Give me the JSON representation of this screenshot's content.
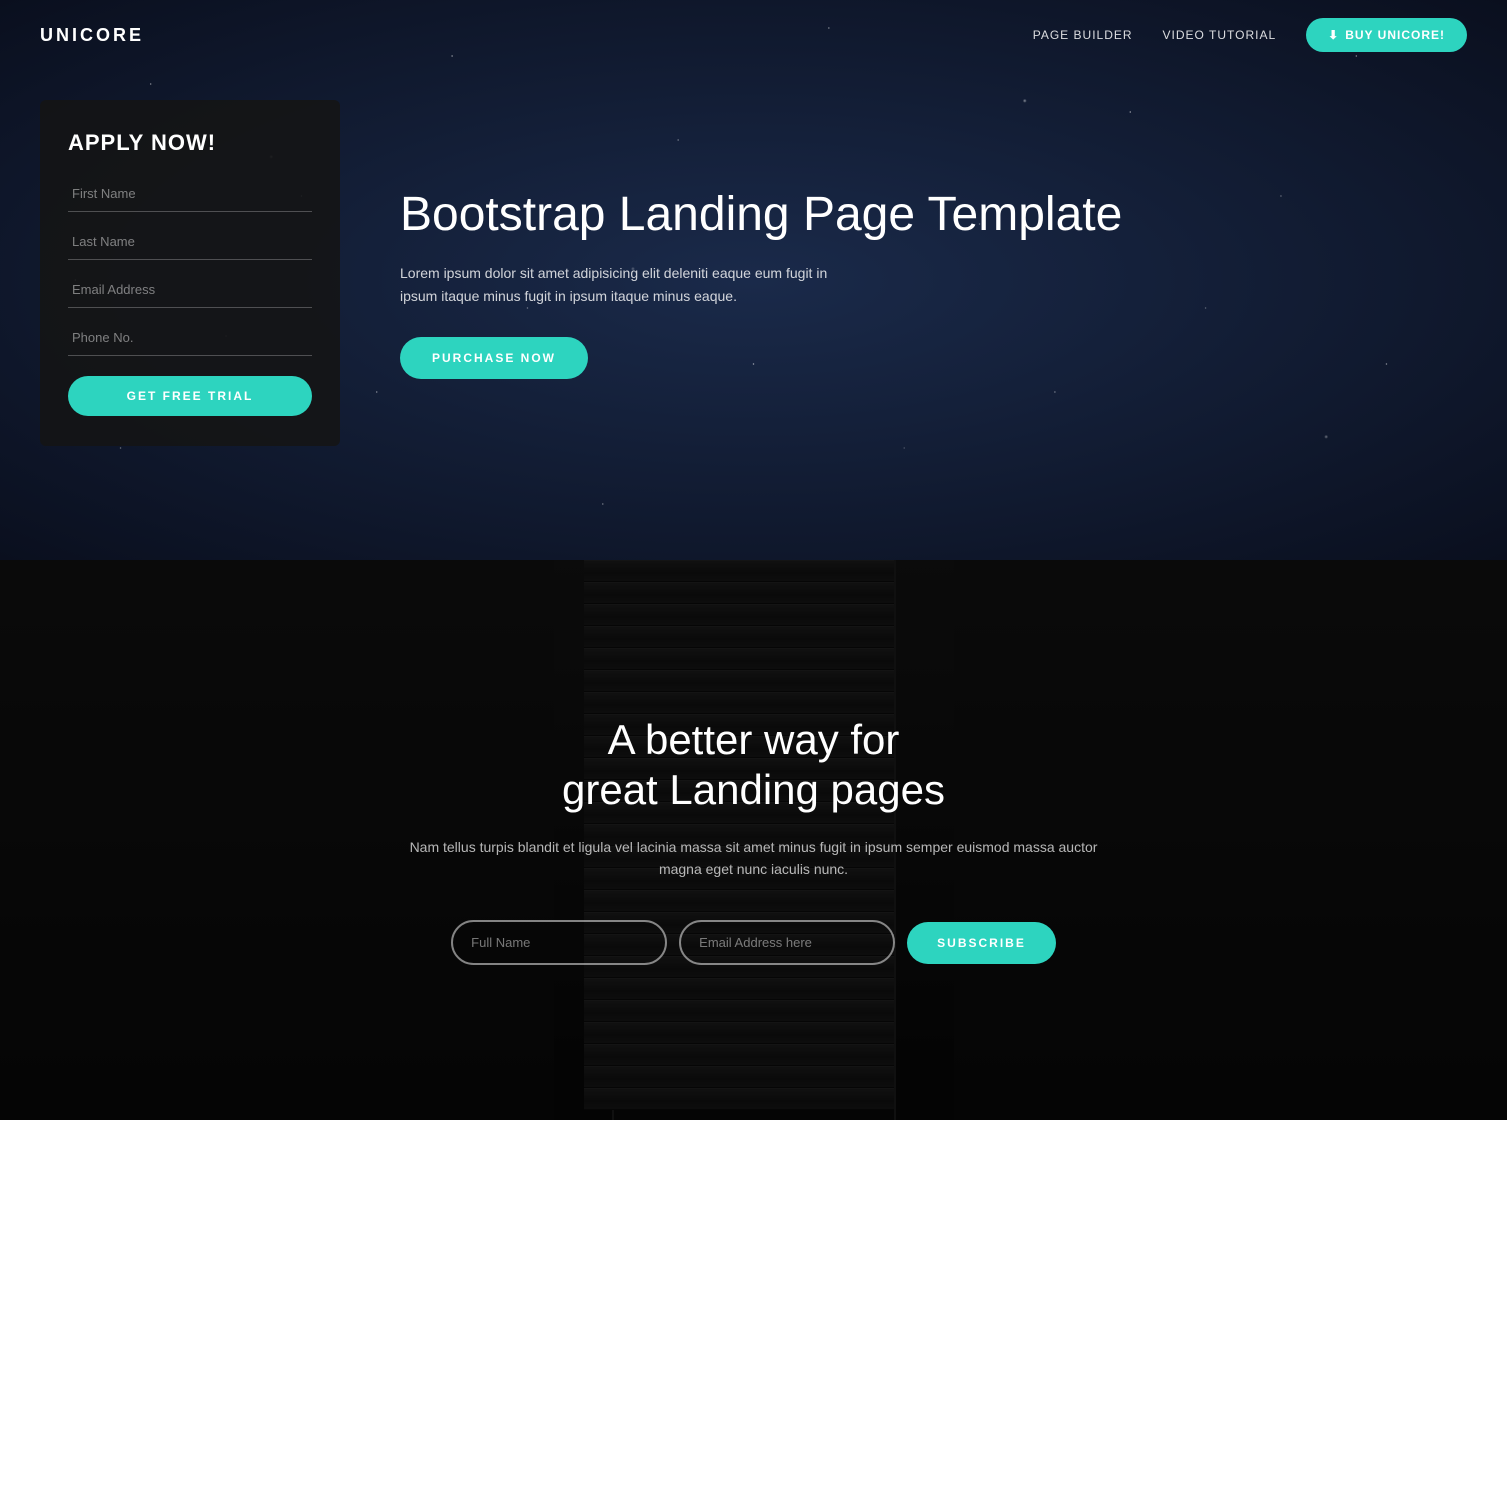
{
  "nav": {
    "logo": "UNICORE",
    "links": [
      {
        "label": "PAGE BUILDER",
        "id": "page-builder-link"
      },
      {
        "label": "VIDEO TUTORIAL",
        "id": "video-tutorial-link"
      }
    ],
    "buy_button": "BUY UNICORE!"
  },
  "hero": {
    "form": {
      "title": "APPLY NOW!",
      "fields": [
        {
          "placeholder": "First Name",
          "id": "first-name-input"
        },
        {
          "placeholder": "Last Name",
          "id": "last-name-input"
        },
        {
          "placeholder": "Email Address",
          "id": "email-address-input"
        },
        {
          "placeholder": "Phone No.",
          "id": "phone-input"
        }
      ],
      "submit_label": "GET FREE TRIAL"
    },
    "heading": "Bootstrap Landing Page Template",
    "paragraph": "Lorem ipsum dolor sit amet adipisicing elit deleniti eaque eum fugit in ipsum itaque minus fugit in ipsum itaque minus eaque.",
    "purchase_button": "PURCHASE NOW"
  },
  "escalator_section": {
    "heading_line1": "A better way for",
    "heading_line2": "great Landing pages",
    "paragraph": "Nam tellus turpis blandit et ligula vel lacinia massa sit amet minus fugit in ipsum semper euismod massa auctor magna eget nunc iaculis nunc.",
    "subscribe": {
      "full_name_placeholder": "Full Name",
      "email_placeholder": "Email Address here",
      "button_label": "SUBSCRIBE"
    }
  }
}
